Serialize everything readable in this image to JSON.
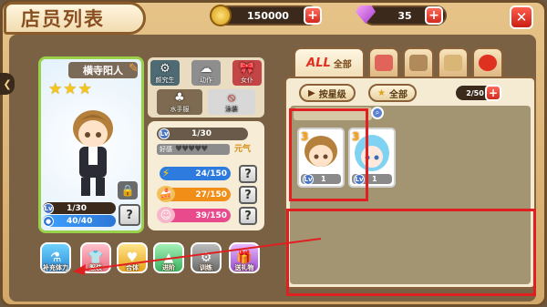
{
  "header": {
    "title": "店员列表",
    "coins": "150000",
    "gems": "35",
    "close_icon": "close-icon"
  },
  "character": {
    "name": "横寺阳人",
    "stars": "★★★",
    "level": "1/30",
    "energy": "40/40"
  },
  "skills": [
    {
      "label": "颜究生"
    },
    {
      "label": "动作"
    },
    {
      "label": "女仆"
    },
    {
      "label": "水手服"
    },
    {
      "label": "泳装"
    }
  ],
  "stats": {
    "level": "1/30",
    "favor_label": "好感",
    "favor_hearts": "♥♥♥♥♥",
    "yuanqi_label": "元气",
    "stat1": "24/150",
    "stat2": "27/150",
    "stat3": "39/150",
    "colors": {
      "stat1": "#2e7be0",
      "stat2": "#f08e18",
      "stat3": "#e84a8c"
    }
  },
  "actions": [
    {
      "label": "补充体力",
      "icon": "stamina-icon"
    },
    {
      "label": "服装",
      "icon": "costume-icon"
    },
    {
      "label": "合体",
      "icon": "merge-icon"
    },
    {
      "label": "进阶",
      "icon": "promote-icon"
    },
    {
      "label": "训练",
      "icon": "train-icon"
    },
    {
      "label": "送礼物",
      "icon": "gift-icon"
    }
  ],
  "roster": {
    "tab_all_prefix": "ALL",
    "tab_all_label": "全部",
    "sort_label": "按星级",
    "filter_label": "全部",
    "count": "2/50",
    "heroes": [
      {
        "number": "3",
        "level": "1"
      },
      {
        "number": "3",
        "level": "1"
      }
    ]
  }
}
